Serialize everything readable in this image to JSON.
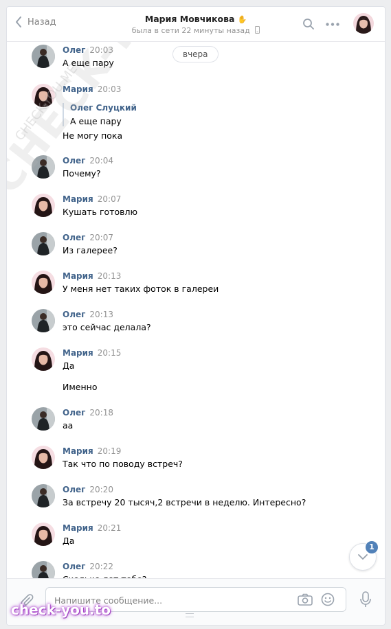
{
  "header": {
    "back_label": "Назад",
    "contact_name": "Мария Мовчикова",
    "status": "была в сети 22 минуты назад"
  },
  "feed": {
    "date_separator": "вчера",
    "messages": [
      {
        "author": "Олег",
        "time": "20:03",
        "lines": [
          "А еще пару"
        ],
        "avatar": "oleg"
      },
      {
        "author": "Мария",
        "time": "20:03",
        "quote": {
          "name": "Олег Слуцкий",
          "text": "А еще пару"
        },
        "lines": [
          "Не могу пока"
        ],
        "avatar": "maria"
      },
      {
        "author": "Олег",
        "time": "20:04",
        "lines": [
          "Почему?"
        ],
        "avatar": "oleg"
      },
      {
        "author": "Мария",
        "time": "20:07",
        "lines": [
          "Кушать готовлю"
        ],
        "avatar": "maria"
      },
      {
        "author": "Олег",
        "time": "20:07",
        "lines": [
          "Из галерее?"
        ],
        "avatar": "oleg"
      },
      {
        "author": "Мария",
        "time": "20:13",
        "lines": [
          "У меня нет таких фоток в галереи"
        ],
        "avatar": "maria"
      },
      {
        "author": "Олег",
        "time": "20:13",
        "lines": [
          "это сейчас делала?"
        ],
        "avatar": "oleg"
      },
      {
        "author": "Мария",
        "time": "20:15",
        "lines": [
          "Да",
          "Именно"
        ],
        "avatar": "maria"
      },
      {
        "author": "Олег",
        "time": "20:18",
        "lines": [
          "аа"
        ],
        "avatar": "oleg"
      },
      {
        "author": "Мария",
        "time": "20:19",
        "lines": [
          "Так что по поводу встреч?"
        ],
        "avatar": "maria"
      },
      {
        "author": "Олег",
        "time": "20:20",
        "lines": [
          "За встречу 20 тысяч,2 встречи в неделю. Интересно?"
        ],
        "avatar": "oleg"
      },
      {
        "author": "Мария",
        "time": "20:21",
        "lines": [
          "Да"
        ],
        "avatar": "maria"
      },
      {
        "author": "Олег",
        "time": "20:22",
        "lines": [
          "Сколько лет тебе?"
        ],
        "avatar": "oleg"
      }
    ]
  },
  "scroll": {
    "unread_count": "1"
  },
  "composer": {
    "placeholder": "Напишите сообщение..."
  },
  "watermark": {
    "large": "CHECK-YOU.ME",
    "small": "CHECK-YOU.ME",
    "brand": "check-you.to"
  },
  "colors": {
    "accent": "#5181b8",
    "name": "#42648b",
    "background": "#edeef0"
  },
  "icons": {
    "back": "chevron-left-icon",
    "search": "search-icon",
    "more": "more-icon",
    "attach": "paperclip-icon",
    "camera": "camera-icon",
    "emoji": "smile-icon",
    "mic": "microphone-icon",
    "scroll_down": "chevron-down-icon"
  }
}
